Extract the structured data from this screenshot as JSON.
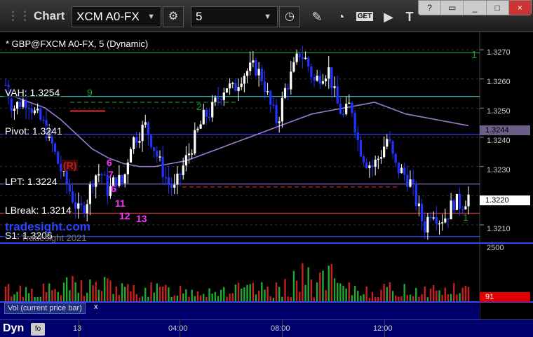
{
  "toolbar": {
    "title": "Chart",
    "symbol": "XCM A0-FX",
    "interval": "5",
    "icons": [
      "settings-icon",
      "clock-icon",
      "pencil-icon",
      "indicator-icon",
      "get-icon",
      "play-icon",
      "text-icon"
    ],
    "get_label": "GET",
    "window_controls": [
      "?",
      "▭",
      "_",
      "□",
      "×"
    ]
  },
  "chart": {
    "series_label": "* GBP@FXCM A0-FX, 5 (Dynamic)",
    "levels": {
      "vah": "VAH: 1.3254",
      "pivot": "Pivot: 1.3241",
      "lpt": "LPT: 1.3224",
      "lbreak": "LBreak: 1.3214",
      "s1": "S1: 1.3206",
      "r_marker": "(R)"
    },
    "axis_labels": [
      "1.3270",
      "1.3260",
      "1.3250",
      "1.3240",
      "1.3230",
      "1.3220",
      "1.3210"
    ],
    "last_price": "1.3220",
    "vwap_tag": "1.3244",
    "watermark": "tradesight.com",
    "copyright": "Tradesight 2021",
    "count_labels": [
      "6",
      "7",
      "6",
      "11",
      "12",
      "13"
    ],
    "green_counts": [
      "9",
      "2",
      "1",
      "1"
    ],
    "right_marker": "1"
  },
  "chart_data": {
    "type": "candlestick",
    "title": "* GBP@FXCM A0-FX, 5 (Dynamic)",
    "ylim": [
      1.3204,
      1.3276
    ],
    "yticks": [
      1.327,
      1.326,
      1.325,
      1.324,
      1.323,
      1.322,
      1.321
    ],
    "levels": [
      {
        "name": "VAH",
        "value": 1.3254,
        "color": "#39c6c6"
      },
      {
        "name": "Pivot",
        "value": 1.3241,
        "color": "#3344ff"
      },
      {
        "name": "LPT",
        "value": 1.3224,
        "color": "#9a7bd1"
      },
      {
        "name": "LBreak",
        "value": 1.3214,
        "color": "#e03030"
      },
      {
        "name": "S1",
        "value": 1.3206,
        "color": "#3344ff"
      },
      {
        "name": "top",
        "value": 1.3269,
        "color": "#2aa13b"
      }
    ],
    "price_path": [
      1.3258,
      1.325,
      1.3252,
      1.3253,
      1.3248,
      1.3245,
      1.324,
      1.3232,
      1.3226,
      1.322,
      1.3214,
      1.3218,
      1.3227,
      1.3228,
      1.3221,
      1.3226,
      1.3224,
      1.3238,
      1.3241,
      1.3244,
      1.3238,
      1.3231,
      1.3225,
      1.3222,
      1.3229,
      1.3235,
      1.3241,
      1.3247,
      1.3249,
      1.3254,
      1.3258,
      1.3256,
      1.3261,
      1.3263,
      1.3264,
      1.326,
      1.3251,
      1.3245,
      1.3256,
      1.3262,
      1.3269,
      1.3266,
      1.3259,
      1.3262,
      1.3263,
      1.3252,
      1.3247,
      1.3252,
      1.3238,
      1.3232,
      1.323,
      1.3234,
      1.324,
      1.323,
      1.3228,
      1.3225,
      1.3217,
      1.3209,
      1.3216,
      1.3212,
      1.3213,
      1.3218,
      1.3217,
      1.322
    ],
    "vwap_path": [
      1.3254,
      1.3252,
      1.325,
      1.3246,
      1.3241,
      1.3236,
      1.3233,
      1.3231,
      1.323,
      1.323,
      1.3231,
      1.3232,
      1.3234,
      1.3236,
      1.3238,
      1.324,
      1.3242,
      1.3244,
      1.3246,
      1.3248,
      1.3249,
      1.325,
      1.3251,
      1.3252,
      1.325,
      1.3248,
      1.3247,
      1.3246,
      1.3245,
      1.3244
    ],
    "volume_max": 2500,
    "volume_last": 91,
    "x_ticks": [
      "13",
      "04:00",
      "08:00",
      "12:00"
    ]
  },
  "volume": {
    "axis_label": "2500",
    "last_label": "91",
    "legend": "Vol (current price bar)",
    "close": "x"
  },
  "bottom": {
    "mode": "Dyn",
    "mode_button": "fo",
    "times": [
      "13",
      "04:00",
      "08:00",
      "12:00"
    ]
  }
}
